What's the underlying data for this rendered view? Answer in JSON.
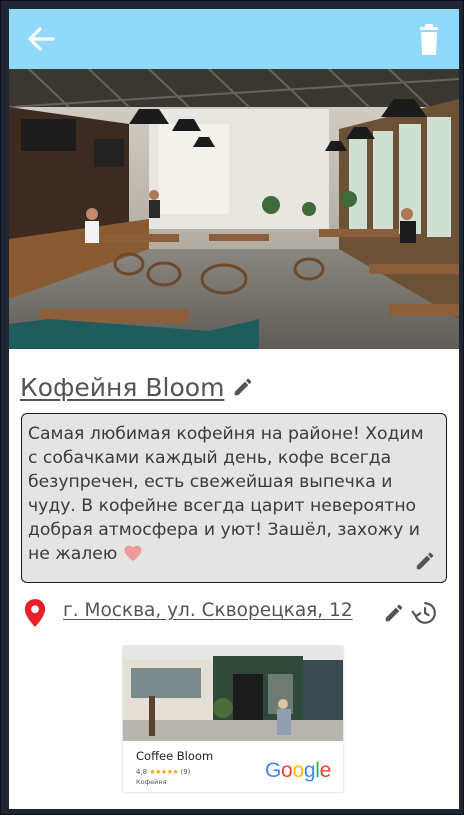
{
  "appbar": {
    "back_icon": "arrow-left-icon",
    "delete_icon": "trash-icon",
    "color": "#90d9fb"
  },
  "hero": {
    "description_icon": "cafe-interior-photo"
  },
  "place": {
    "title": "Кофейня Bloom",
    "description": "Самая любимая кофейня на районе! Ходим с собачками каждый день, кофе всегда безупречен, есть свежейшая выпечка и чуду. В кофейне всегда царит невероятно добрая атмосфера и уют! Зашёл, захожу и не жалею",
    "address": "г. Москва, ул. Скворецкая, 12"
  },
  "map_card": {
    "name": "Coffee Bloom",
    "rating": "4,8",
    "stars": "★★★★★",
    "reviews": "(9)",
    "category": "Кофейня",
    "brand_letters": [
      "G",
      "o",
      "o",
      "g",
      "l",
      "e"
    ]
  },
  "colors": {
    "pin": "#e8202a",
    "icon_gray": "#545454"
  }
}
